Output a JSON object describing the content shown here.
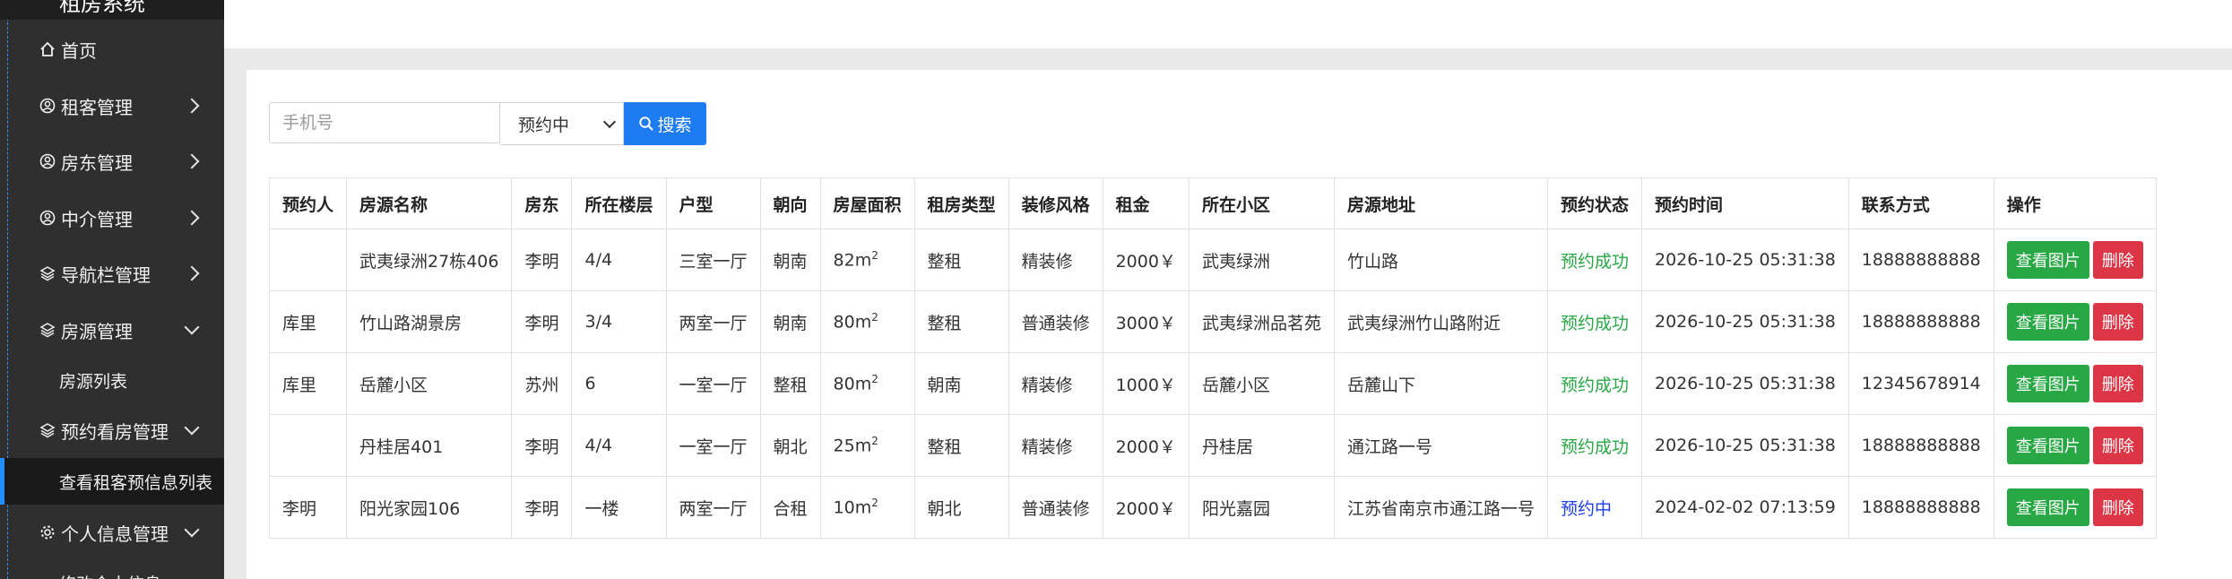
{
  "sidebar": {
    "logo_text": "租房系统",
    "home": "首页",
    "items": [
      {
        "label": "租客管理",
        "icon": "user-circle-icon"
      },
      {
        "label": "房东管理",
        "icon": "user-circle-icon"
      },
      {
        "label": "中介管理",
        "icon": "user-circle-icon"
      },
      {
        "label": "导航栏管理",
        "icon": "layers-icon"
      },
      {
        "label": "房源管理",
        "icon": "layers-icon",
        "sub": "房源列表"
      },
      {
        "label": "预约看房管理",
        "icon": "layers-icon",
        "sub": "查看租客预信息列表"
      },
      {
        "label": "个人信息管理",
        "icon": "gear-icon",
        "sub": "修改个人信息"
      }
    ]
  },
  "search": {
    "phone_placeholder": "手机号",
    "status_selected": "预约中",
    "button_label": "搜索"
  },
  "table": {
    "headers": [
      "预约人",
      "房源名称",
      "房东",
      "所在楼层",
      "户型",
      "朝向",
      "房屋面积",
      "租房类型",
      "装修风格",
      "租金",
      "所在小区",
      "房源地址",
      "预约状态",
      "预约时间",
      "联系方式",
      "操作"
    ],
    "rows": [
      {
        "person": "",
        "name": "武夷绿洲27栋406",
        "landlord": "李明",
        "floor": "4/4",
        "layout": "三室一厅",
        "orient": "朝南",
        "area": "82m",
        "type": "整租",
        "deco": "精装修",
        "rent": "2000￥",
        "community": "武夷绿洲",
        "address": "竹山路",
        "status": "预约成功",
        "time": "2026-10-25 05:31:38",
        "contact": "18888888888"
      },
      {
        "person": "库里",
        "name": "竹山路湖景房",
        "landlord": "李明",
        "floor": "3/4",
        "layout": "两室一厅",
        "orient": "朝南",
        "area": "80m",
        "type": "整租",
        "deco": "普通装修",
        "rent": "3000￥",
        "community": "武夷绿洲品茗苑",
        "address": "武夷绿洲竹山路附近",
        "status": "预约成功",
        "time": "2026-10-25 05:31:38",
        "contact": "18888888888"
      },
      {
        "person": "库里",
        "name": "岳麓小区",
        "landlord": "苏州",
        "floor": "6",
        "layout": "一室一厅",
        "orient": "整租",
        "area": "80m",
        "type": "朝南",
        "deco": "精装修",
        "rent": "1000￥",
        "community": "岳麓小区",
        "address": "岳麓山下",
        "status": "预约成功",
        "time": "2026-10-25 05:31:38",
        "contact": "12345678914"
      },
      {
        "person": "",
        "name": "丹桂居401",
        "landlord": "李明",
        "floor": "4/4",
        "layout": "一室一厅",
        "orient": "朝北",
        "area": "25m",
        "type": "整租",
        "deco": "精装修",
        "rent": "2000￥",
        "community": "丹桂居",
        "address": "通江路一号",
        "status": "预约成功",
        "time": "2026-10-25 05:31:38",
        "contact": "18888888888"
      },
      {
        "person": "李明",
        "name": "阳光家园106",
        "landlord": "李明",
        "floor": "一楼",
        "layout": "两室一厅",
        "orient": "合租",
        "area": "10m",
        "type": "朝北",
        "deco": "普通装修",
        "rent": "2000￥",
        "community": "阳光嘉园",
        "address": "江苏省南京市通江路一号",
        "status": "预约中",
        "time": "2024-02-02 07:13:59",
        "contact": "18888888888"
      }
    ],
    "area_sup": "2",
    "view_label": "查看图片",
    "delete_label": "删除"
  },
  "colors": {
    "sidebar_bg": "#2f2f2f",
    "success": "#28a745",
    "pending": "#1e3cf0",
    "primary": "#1e7cf2",
    "danger": "#dc3545"
  }
}
